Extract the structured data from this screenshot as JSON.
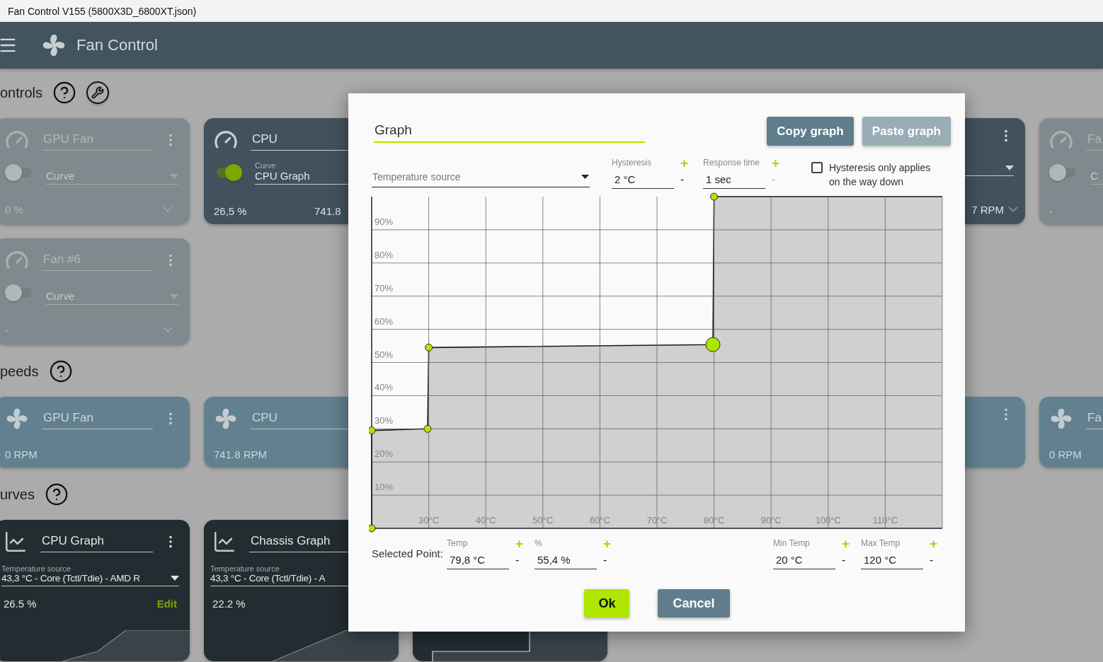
{
  "window": {
    "title": "Fan Control V155 (5800X3D_6800XT.json)"
  },
  "app_bar": {
    "title": "Fan Control"
  },
  "sections": [
    {
      "kind": "controls",
      "title": "ontrols",
      "rows": [
        {
          "left": [
            {
              "kind": "control",
              "name": "GPU Fan",
              "menu": true,
              "enabled": false,
              "curve": "Curve",
              "value": "0 %"
            },
            {
              "kind": "control",
              "name": "CPU",
              "enabled": true,
              "curve_label": "Curve",
              "curve": "CPU Graph",
              "value": "26,5 %",
              "rpm": "741.8"
            }
          ],
          "right": [
            {
              "kind": "control",
              "menu": true,
              "rpm": "7 RPM"
            },
            {
              "kind": "control",
              "name": "Fa",
              "enabled": false,
              "curve": "C",
              "value": "-"
            }
          ]
        },
        {
          "left": [
            {
              "kind": "control",
              "name": "Fan #6",
              "menu": true,
              "enabled": false,
              "curve": "Curve",
              "value": "-"
            }
          ]
        }
      ]
    },
    {
      "kind": "speeds",
      "title": "peeds",
      "rows": [
        {
          "left": [
            {
              "kind": "speed",
              "name": "GPU Fan",
              "menu": true,
              "rpm": "0 RPM"
            },
            {
              "kind": "speed",
              "name": "CPU",
              "rpm": "741.8 RPM"
            }
          ],
          "right": [
            {
              "kind": "speed",
              "menu": true
            },
            {
              "kind": "speed",
              "name": "Fa",
              "rpm": "0 RPM"
            }
          ]
        }
      ]
    },
    {
      "kind": "curves",
      "title": "urves",
      "rows": [
        {
          "left": [
            {
              "kind": "curve",
              "name": "CPU Graph",
              "menu": true,
              "source_label": "Temperature source",
              "source": "43,3 °C - Core (Tctl/Tdie) - AMD R",
              "value": "26.5 %",
              "action": "Edit"
            },
            {
              "kind": "curve",
              "name": "Chassis Graph",
              "source_label": "Temperature source",
              "source": "43,3 °C - Core (Tctl/Tdie) - A",
              "value": "22.2 %"
            },
            {
              "kind": "curve"
            }
          ]
        }
      ]
    }
  ],
  "dialog": {
    "name": "Graph",
    "buttons": [
      {
        "label": "Copy graph",
        "disabled": false
      },
      {
        "label": "Paste graph",
        "disabled": true
      }
    ],
    "temperature_source": {
      "placeholder": "Temperature source"
    },
    "steppers": [
      {
        "label": "Hysteresis",
        "value": "2 °C",
        "plus": {
          "text": "+",
          "disabled": false
        },
        "minus": {
          "text": "-",
          "disabled": false
        }
      },
      {
        "label": "Response time",
        "value": "1 sec",
        "plus": {
          "text": "+",
          "disabled": false
        },
        "minus": {
          "text": "-",
          "disabled": true
        }
      }
    ],
    "hysteresis_option": {
      "label": "Hysteresis only applies on the way down",
      "checked": false
    },
    "chart_data": {
      "type": "area",
      "x": [
        20,
        20,
        29.8,
        30,
        79.8,
        80,
        120
      ],
      "series": [
        {
          "color": "#d0d0d0",
          "values": [
            0,
            29.5,
            30,
            54.5,
            55.4,
            100,
            100
          ]
        }
      ],
      "xlim": [
        20,
        120
      ],
      "ylim": [
        0,
        100
      ],
      "grid": true,
      "xticks": [
        {
          "value": 30,
          "label": "30°C"
        },
        {
          "value": 40,
          "label": "40°C"
        },
        {
          "value": 50,
          "label": "50°C"
        },
        {
          "value": 60,
          "label": "60°C"
        },
        {
          "value": 70,
          "label": "70°C"
        },
        {
          "value": 80,
          "label": "80°C"
        },
        {
          "value": 90,
          "label": "90°C"
        },
        {
          "value": 100,
          "label": "100°C"
        },
        {
          "value": 110,
          "label": "110°C"
        }
      ],
      "yticks": [
        {
          "value": 10,
          "label": "10%"
        },
        {
          "value": 20,
          "label": "20%"
        },
        {
          "value": 30,
          "label": "30%"
        },
        {
          "value": 40,
          "label": "40%"
        },
        {
          "value": 50,
          "label": "50%"
        },
        {
          "value": 60,
          "label": "60%"
        },
        {
          "value": 70,
          "label": "70%"
        },
        {
          "value": 80,
          "label": "80%"
        },
        {
          "value": 90,
          "label": "90%"
        }
      ]
    },
    "points": [
      {
        "selected": false
      },
      {
        "selected": false
      },
      {
        "selected": false
      },
      {
        "selected": false
      },
      {
        "selected": true
      },
      {
        "selected": false
      }
    ],
    "selected_point": {
      "label": "Selected Point:",
      "fields": [
        {
          "label": "Temp",
          "value": "79,8 °C",
          "plus": {
            "text": "+",
            "disabled": false
          },
          "minus": {
            "text": "-",
            "disabled": false
          }
        },
        {
          "label": "%",
          "value": "55,4 %",
          "plus": {
            "text": "+",
            "disabled": false
          },
          "minus": {
            "text": "-",
            "disabled": false
          }
        }
      ]
    },
    "range_fields": [
      {
        "label": "Min Temp",
        "value": "20 °C",
        "plus": {
          "text": "+",
          "disabled": false
        },
        "minus": {
          "text": "-",
          "disabled": false
        }
      },
      {
        "label": "Max Temp",
        "value": "120 °C",
        "plus": {
          "text": "+",
          "disabled": false
        },
        "minus": {
          "text": "-",
          "disabled": false
        }
      }
    ],
    "actions": [
      {
        "label": "Ok",
        "kind": "primary"
      },
      {
        "label": "Cancel",
        "kind": "secondary"
      }
    ]
  }
}
